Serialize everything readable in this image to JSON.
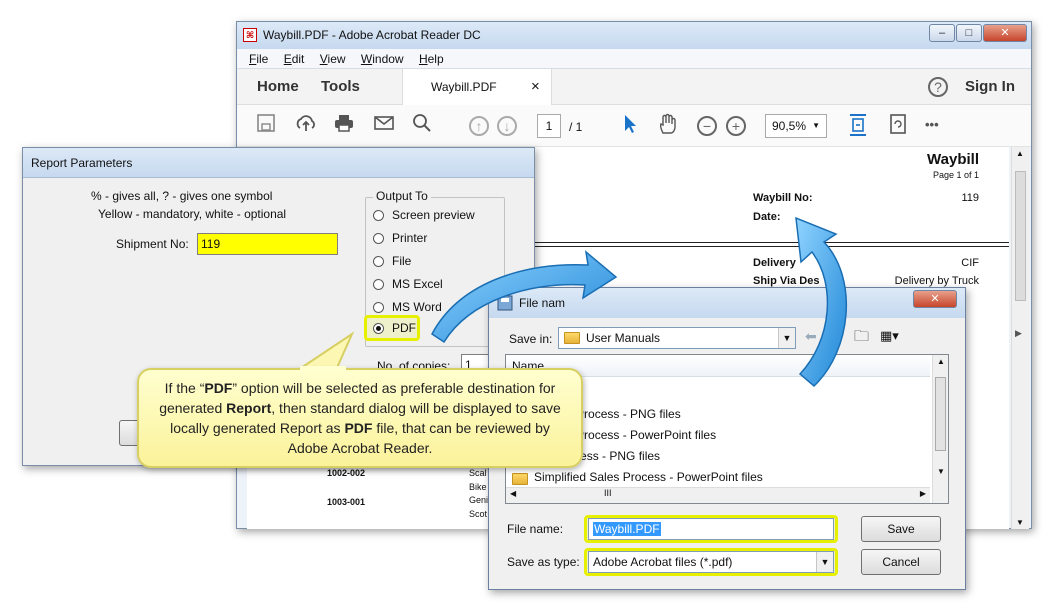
{
  "acrobat": {
    "title": "Waybill.PDF - Adobe Acrobat Reader DC",
    "menu": [
      "File",
      "Edit",
      "View",
      "Window",
      "Help"
    ],
    "nav": {
      "home": "Home",
      "tools": "Tools",
      "tab": "Waybill.PDF",
      "tab_close": "×",
      "help": "?",
      "sign_in": "Sign In"
    },
    "toolbar": {
      "page_current": "1",
      "page_total": "/ 1",
      "zoom": "90,5%",
      "more": "•••"
    },
    "document": {
      "title": "Waybill",
      "page_info": "Page 1 of 1",
      "waybill_no_label": "Waybill No:",
      "waybill_no_value": "119",
      "date_label": "Date:",
      "delivery_label": "Delivery",
      "delivery_value": "CIF",
      "ship_via_label": "Ship Via Des",
      "ship_via_value": "Delivery by Truck",
      "row1_code": "1002-002",
      "row1_desc1": "Scal",
      "row1_desc2": "Bike",
      "row2_code": "1003-001",
      "row2_desc1": "Geni",
      "row2_desc2": "Scot"
    }
  },
  "report": {
    "title": "Report Parameters",
    "hint1": "% - gives all, ? - gives one symbol",
    "hint2": "Yellow - mandatory, white - optional",
    "shipment_label": "Shipment No:",
    "shipment_value": "119",
    "output_label": "Output To",
    "options": [
      "Screen preview",
      "Printer",
      "File",
      "MS Excel",
      "MS Word",
      "PDF"
    ],
    "selected_option": "PDF",
    "copies_label": "No. of copies:",
    "copies_value": "1"
  },
  "save_dialog": {
    "title": "File nam",
    "save_in_label": "Save in:",
    "save_in_value": "User Manuals",
    "column_name": "Name",
    "files": [
      "d Purchase Process - PNG files",
      "d Purchase Process - PowerPoint files",
      "d Sales Process - PNG files",
      "Simplified Sales Process - PowerPoint files"
    ],
    "filename_label": "File name:",
    "filename_value": "Waybill.PDF",
    "type_label": "Save as type:",
    "type_value": "Adobe Acrobat files (*.pdf)",
    "save_button": "Save",
    "cancel_button": "Cancel"
  },
  "callout": {
    "parts": [
      "If the “",
      "PDF",
      "” option will be selected as preferable destination for generated ",
      "Report",
      ", then standard dialog will be displayed to save locally generated Report as ",
      "PDF",
      " file, that can be reviewed by Adobe Acrobat Reader."
    ]
  },
  "colors": {
    "highlight": "#e6f000",
    "arrow": "#2f9be0",
    "accent_blue": "#1a73c9"
  }
}
